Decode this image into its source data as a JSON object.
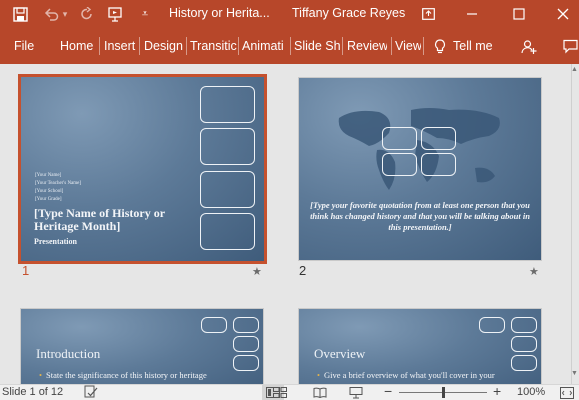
{
  "title_bar": {
    "doc_title": "History or Herita...",
    "user_name": "Tiffany Grace Reyes",
    "icons": [
      "save-icon",
      "undo-icon",
      "redo-icon",
      "start-from-beginning-icon",
      "customize-toolbar-icon",
      "ribbon-display-options-icon",
      "minimize-icon",
      "maximize-icon",
      "close-icon"
    ]
  },
  "ribbon": {
    "tabs": [
      "File",
      "Home",
      "Insert",
      "Design",
      "Transitic",
      "Animati",
      "Slide Sh",
      "Review",
      "View"
    ],
    "tell_me": "Tell me",
    "icons": [
      "lightbulb-icon",
      "share-icon"
    ]
  },
  "slides": [
    {
      "number": "1",
      "selected": true,
      "small_lines": [
        "[Your Name]",
        "[Your Teacher's Name]",
        "[Your School]",
        "[Your Grade]"
      ],
      "title": "[Type Name of History or Heritage Month]",
      "subtitle": "Presentation"
    },
    {
      "number": "2",
      "quote": "[Type your favorite quotation from at least one person that you think has changed history and that you will be talking about in this presentation.]"
    },
    {
      "title": "Introduction",
      "bullet": "State the significance of this history or heritage"
    },
    {
      "title": "Overview",
      "bullet": "Give a brief overview of what you'll cover in your"
    }
  ],
  "status_bar": {
    "slide_info": "Slide 1 of 12",
    "zoom": "100%",
    "icons": [
      "spell-check-icon",
      "normal-view-icon",
      "slide-sorter-icon",
      "reading-view-icon",
      "slide-show-icon",
      "zoom-out-icon",
      "zoom-in-icon",
      "fit-to-window-icon"
    ],
    "zoom_level": 0.5
  },
  "colors": {
    "accent": "#b7472a",
    "selection": "#c5512e",
    "slide_bg": "#5d7a98",
    "bullet": "#e2b24a"
  }
}
